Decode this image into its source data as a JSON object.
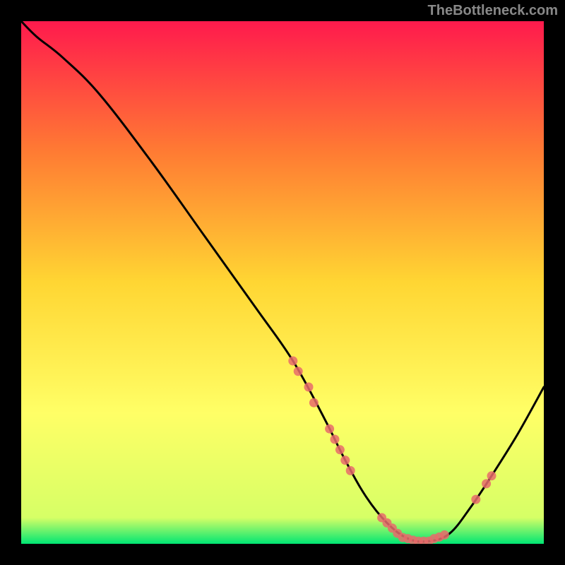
{
  "attribution": "TheBottleneck.com",
  "chart_data": {
    "type": "line",
    "title": "",
    "xlabel": "",
    "ylabel": "",
    "xlim": [
      0,
      100
    ],
    "ylim": [
      0,
      100
    ],
    "gradient_stops": [
      {
        "offset": 0,
        "color": "#ff1a4d"
      },
      {
        "offset": 25,
        "color": "#ff7b33"
      },
      {
        "offset": 50,
        "color": "#ffd633"
      },
      {
        "offset": 75,
        "color": "#ffff66"
      },
      {
        "offset": 95,
        "color": "#d6ff66"
      },
      {
        "offset": 100,
        "color": "#00e673"
      }
    ],
    "curve": {
      "x": [
        0,
        3,
        8,
        15,
        25,
        35,
        45,
        52,
        58,
        62,
        66,
        70,
        74,
        78,
        82,
        86,
        90,
        95,
        100
      ],
      "y": [
        100,
        97,
        93,
        86,
        73,
        59,
        45,
        35,
        24,
        16,
        9,
        4,
        1,
        0.5,
        2,
        7,
        13,
        21,
        30
      ]
    },
    "markers": [
      {
        "x": 52,
        "y": 35
      },
      {
        "x": 53,
        "y": 33
      },
      {
        "x": 55,
        "y": 30
      },
      {
        "x": 56,
        "y": 27
      },
      {
        "x": 59,
        "y": 22
      },
      {
        "x": 60,
        "y": 20
      },
      {
        "x": 61,
        "y": 18
      },
      {
        "x": 62,
        "y": 16
      },
      {
        "x": 63,
        "y": 14
      },
      {
        "x": 69,
        "y": 5
      },
      {
        "x": 70,
        "y": 4
      },
      {
        "x": 71,
        "y": 3
      },
      {
        "x": 72,
        "y": 2
      },
      {
        "x": 73,
        "y": 1.2
      },
      {
        "x": 74,
        "y": 1
      },
      {
        "x": 75,
        "y": 0.7
      },
      {
        "x": 76,
        "y": 0.5
      },
      {
        "x": 77,
        "y": 0.5
      },
      {
        "x": 78,
        "y": 0.5
      },
      {
        "x": 79,
        "y": 1
      },
      {
        "x": 80,
        "y": 1.3
      },
      {
        "x": 81,
        "y": 1.7
      },
      {
        "x": 87,
        "y": 8.5
      },
      {
        "x": 89,
        "y": 11.5
      },
      {
        "x": 90,
        "y": 13
      }
    ]
  }
}
